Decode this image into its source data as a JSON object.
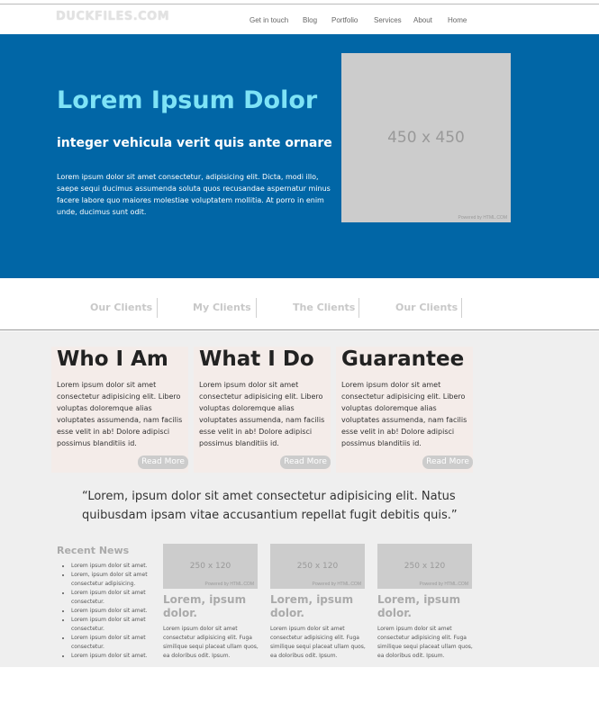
{
  "header": {
    "logo": "DUCKFILES.COM",
    "nav": [
      {
        "label": "Get in touch"
      },
      {
        "label": "Blog"
      },
      {
        "label": "Portfolio"
      },
      {
        "label": "Services"
      },
      {
        "label": "About"
      },
      {
        "label": "Home"
      }
    ]
  },
  "hero": {
    "title": "Lorem Ipsum Dolor",
    "subtitle": "integer vehicula verit quis ante ornare",
    "text": "Lorem ipsum dolor sit amet consectetur, adipisicing elit. Dicta, modi illo, saepe sequi ducimus assumenda soluta quos recusandae aspernatur minus facere labore quo maiores molestiae voluptatem mollitia. At porro in enim unde, ducimus sunt odit.",
    "image_label": "450 x 450",
    "image_powered": "Powered by HTML.COM"
  },
  "clients": [
    {
      "label": "Our Clients"
    },
    {
      "label": "My Clients"
    },
    {
      "label": "The Clients"
    },
    {
      "label": "Our Clients"
    }
  ],
  "features": [
    {
      "title": "Who I Am",
      "text": "Lorem ipsum dolor sit amet consectetur adipisicing elit. Libero voluptas doloremque alias voluptates assumenda, nam facilis esse velit in ab! Dolore adipisci possimus blanditiis id.",
      "button": "Read More"
    },
    {
      "title": "What I Do",
      "text": "Lorem ipsum dolor sit amet consectetur adipisicing elit. Libero voluptas doloremque alias voluptates assumenda, nam facilis esse velit in ab! Dolore adipisci possimus blanditiis id.",
      "button": "Read More"
    },
    {
      "title": "Guarantee",
      "text": "Lorem ipsum dolor sit amet consectetur adipisicing elit. Libero voluptas doloremque alias voluptates assumenda, nam facilis esse velit in ab! Dolore adipisci possimus blanditiis id.",
      "button": "Read More"
    }
  ],
  "quote": "“Lorem, ipsum dolor sit amet consectetur adipisicing elit. Natus quibusdam ipsam vitae accusantium repellat fugit debitis quis.”",
  "news": {
    "title": "Recent News",
    "items": [
      "Lorem ipsum dolor sit amet.",
      "Lorem, ipsum dolor sit amet consectetur adipisicing.",
      "Lorem ipsum dolor sit amet consectetur.",
      "Lorem ipsum dolor sit amet.",
      "Lorem ipsum dolor sit amet consectetur.",
      "Lorem ipsum dolor sit amet consectetur.",
      "Lorem ipsum dolor sit amet."
    ]
  },
  "cards": [
    {
      "image_label": "250 x 120",
      "image_powered": "Powered by HTML.COM",
      "title": "Lorem, ipsum dolor.",
      "text": "Lorem ipsum dolor sit amet consectetur adipisicing elit. Fuga similique sequi placeat ullam quos, ea doloribus odit. Ipsum."
    },
    {
      "image_label": "250 x 120",
      "image_powered": "Powered by HTML.COM",
      "title": "Lorem, ipsum dolor.",
      "text": "Lorem ipsum dolor sit amet consectetur adipisicing elit. Fuga similique sequi placeat ullam quos, ea doloribus odit. Ipsum."
    },
    {
      "image_label": "250 x 120",
      "image_powered": "Powered by HTML.COM",
      "title": "Lorem, ipsum dolor.",
      "text": "Lorem ipsum dolor sit amet consectetur adipisicing elit. Fuga similique sequi placeat ullam quos, ea doloribus odit. Ipsum."
    }
  ],
  "colors": {
    "hero_bg": "#0166a6",
    "hero_title": "#7ee3f6",
    "section_bg": "#efefef",
    "placeholder": "#cccccc"
  }
}
